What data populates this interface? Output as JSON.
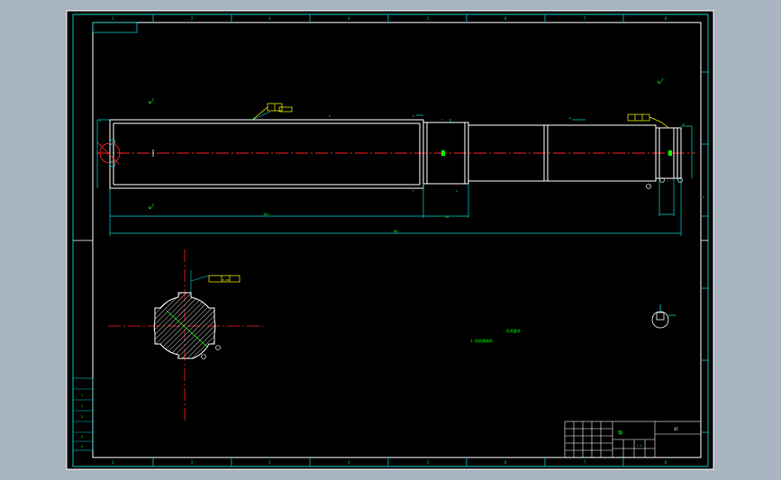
{
  "colors": {
    "background": "#a9b4c2",
    "paper": "#000000",
    "frame": "#ffffff",
    "border": "#00c8c8",
    "outline": "#ffffff",
    "dimension": "#00d8d8",
    "annotation": "#00ff00",
    "centerline": "#ff2020",
    "tolerance": "#ffff00",
    "hatch": "#ffffff"
  },
  "zone_labels": {
    "top": [
      "1",
      "2",
      "3",
      "4",
      "5",
      "6",
      "7",
      "8",
      "9",
      "10",
      "11",
      "12"
    ],
    "bottom": [
      "1",
      "2",
      "3",
      "4",
      "5",
      "6",
      "7",
      "8",
      "9",
      "10",
      "11",
      "12"
    ]
  },
  "main_view": {
    "length_dim": "88",
    "sub_length_dim": "181",
    "step_dim": "28"
  },
  "section_view": {
    "tolerance_label": "0.03"
  },
  "notes": {
    "line1": "1.热处理调质",
    "line2": "技术要求"
  },
  "title_block": {
    "drawing_name": "轴",
    "material": "45",
    "scale": "1:1"
  },
  "left_table": {
    "rows": [
      "1",
      "2",
      "3",
      "4",
      "5"
    ]
  }
}
